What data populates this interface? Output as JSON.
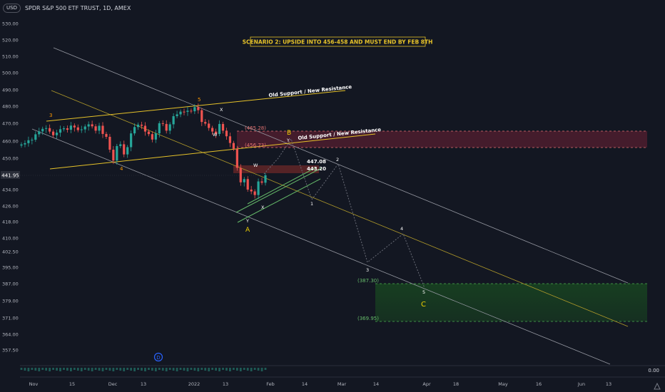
{
  "header": {
    "currency": "USD",
    "title": "SPDR S&P 500 ETF TRUST, 1D, AMEX"
  },
  "price_label": "441.95",
  "volume_label": "0.00",
  "event_marker": "D",
  "colors": {
    "background": "#131722",
    "up": "#26a69a",
    "down": "#ef5350",
    "yellow": "#f0d000",
    "orange": "#ff9800",
    "green": "#2e7d32",
    "pink": "#e91e63"
  },
  "chart_data": {
    "type": "candlestick",
    "x_axis_labels": [
      "Nov",
      "15",
      "Dec",
      "13",
      "2022",
      "13",
      "Feb",
      "14",
      "Mar",
      "14",
      "Apr",
      "18",
      "May",
      "16",
      "Jun",
      "13"
    ],
    "y_axis_labels": [
      "530.00",
      "520.00",
      "510.00",
      "500.00",
      "490.00",
      "480.00",
      "470.00",
      "460.00",
      "450.00",
      "434.00",
      "426.00",
      "418.00",
      "410.00",
      "402.50",
      "395.00",
      "387.00",
      "379.00",
      "371.00",
      "364.00",
      "357.50"
    ],
    "grid": false,
    "closes": [
      458.9,
      459.6,
      461.2,
      461.5,
      464.5,
      466.1,
      467.5,
      467.9,
      466.0,
      464.0,
      465.4,
      467.3,
      467.8,
      467.0,
      469.3,
      468.3,
      466.8,
      467.2,
      468.8,
      470.0,
      468.9,
      466.5,
      469.2,
      464.7,
      463.1,
      456.0,
      450.0,
      458.0,
      459.0,
      453.4,
      457.4,
      465.0,
      468.5,
      469.8,
      469.2,
      466.0,
      464.6,
      461.6,
      465.0,
      470.6,
      470.2,
      466.5,
      470.0,
      474.5,
      475.5,
      477.0,
      476.9,
      477.5,
      477.2,
      479.5,
      477.8,
      471.3,
      470.4,
      468.0,
      466.0,
      464.7,
      470.2,
      466.5,
      463.4,
      459.7,
      456.5,
      446.0,
      438.0,
      439.8,
      434.0,
      433.0,
      431.0,
      438.5,
      437.8,
      441.9
    ],
    "annotations": {
      "scenario_box": "SCENARIO 2: UPSIDE INTO 456-458 AND MUST END BY FEB 8TH",
      "resistance_label_upper": "Old Support / New Resistance",
      "resistance_label_lower": "Old Support / New Resistance",
      "zone_upper_top": "(465.28)",
      "zone_upper_bottom": "(456.73)",
      "zone_lower_top": "(387.30)",
      "zone_lower_bottom": "(369.95)",
      "level_447": "447.08",
      "level_443": "443.20",
      "wave_labels": [
        "3",
        "4",
        "5",
        "X",
        "W",
        "A",
        "Y",
        "W",
        "X",
        "Y",
        "B",
        "Y",
        "1",
        "2",
        "3",
        "4",
        "5",
        "C"
      ]
    }
  }
}
